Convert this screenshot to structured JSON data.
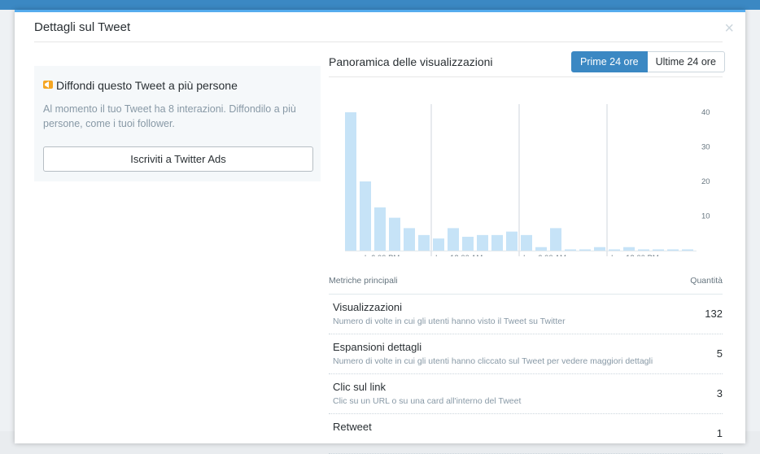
{
  "modal": {
    "title": "Dettagli sul Tweet",
    "close_icon": "close-icon"
  },
  "promo": {
    "icon": "megaphone-icon",
    "title": "Diffondi questo Tweet a più persone",
    "description": "Al momento il tuo Tweet ha 8 interazioni. Diffondilo a più persone, come i tuoi follower.",
    "button_label": "Iscriviti a Twitter Ads"
  },
  "overview": {
    "title": "Panoramica delle visualizzazioni",
    "tabs": [
      {
        "label": "Prime 24 ore",
        "active": true
      },
      {
        "label": "Ultime 24 ore",
        "active": false
      }
    ]
  },
  "chart_data": {
    "type": "bar",
    "bar_color": "#c6e3f7",
    "y_ticks": [
      10,
      20,
      30,
      40
    ],
    "ylim": [
      0,
      40
    ],
    "x_tick_labels": [
      "sab 6:00 PM",
      "dom 12:00 AM",
      "dom 6:00 AM",
      "dom 12:00 PM"
    ],
    "values": [
      40,
      20,
      12.5,
      9.5,
      6.5,
      4.5,
      3.5,
      6.5,
      4,
      4.5,
      4.5,
      5.5,
      4.5,
      1,
      6.5,
      0,
      0,
      1,
      0,
      1,
      0,
      0,
      0,
      0
    ]
  },
  "metrics": {
    "header_left": "Metriche principali",
    "header_right": "Quantità",
    "rows": [
      {
        "name": "Visualizzazioni",
        "desc": "Numero di volte in cui gli utenti hanno visto il Tweet su Twitter",
        "value": "132"
      },
      {
        "name": "Espansioni dettagli",
        "desc": "Numero di volte in cui gli utenti hanno cliccato sul Tweet per vedere maggiori dettagli",
        "value": "5"
      },
      {
        "name": "Clic sul link",
        "desc": "Clic su un URL o su una card all'interno del Tweet",
        "value": "3"
      },
      {
        "name": "Retweet",
        "desc": "",
        "value": "1"
      }
    ]
  }
}
